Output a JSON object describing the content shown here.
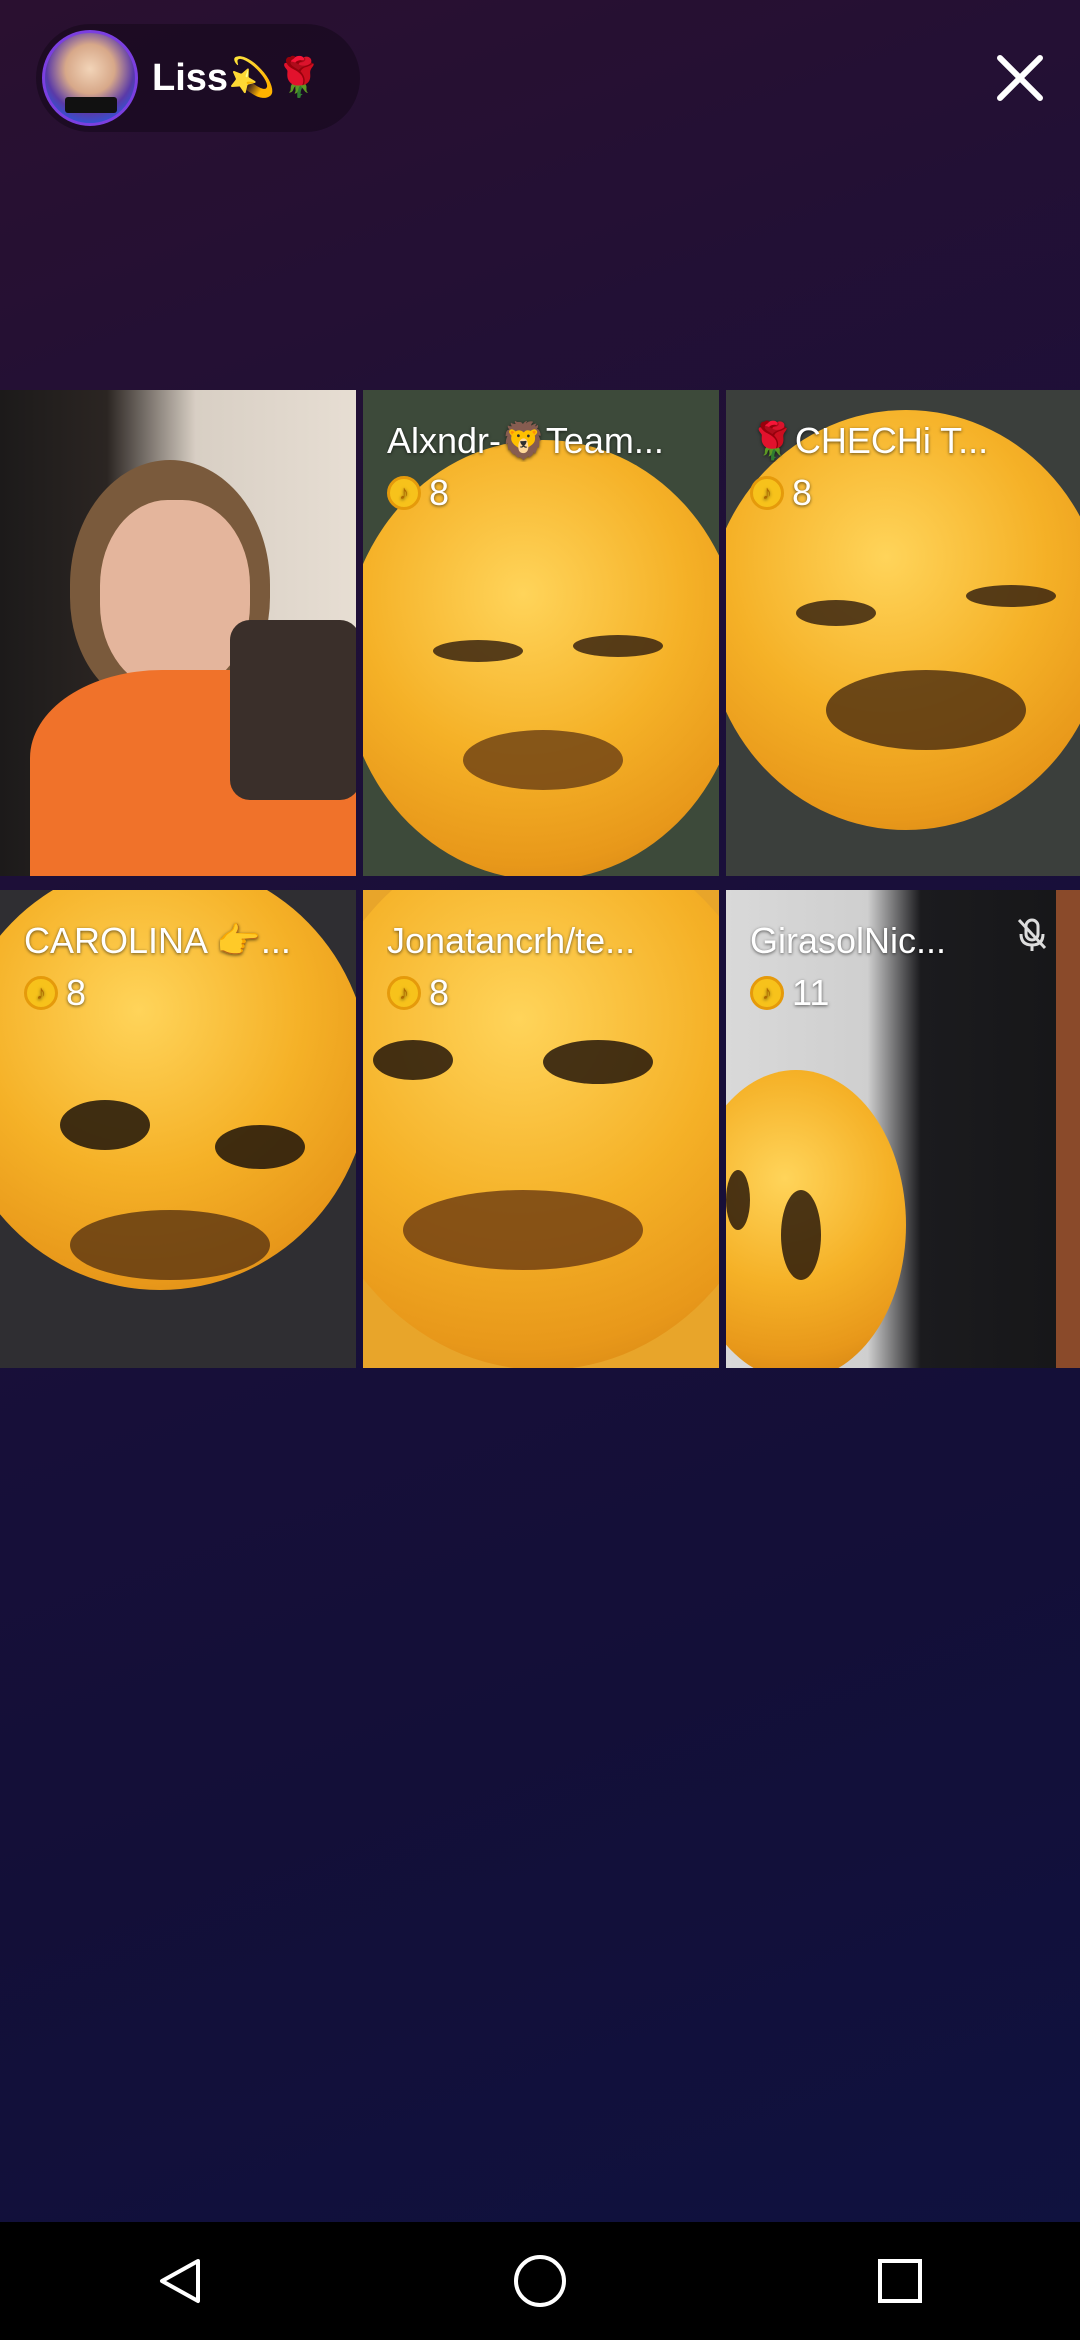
{
  "header": {
    "host_name": "Liss💫🌹",
    "close_icon": "close-icon"
  },
  "tiles": [
    {
      "name": "",
      "coins": ""
    },
    {
      "name": "Alxndr-🦁Team...",
      "coins": "8"
    },
    {
      "name": "🌹CHECHi  T...",
      "coins": "8"
    },
    {
      "name": "CAROLINA 👉...",
      "coins": "8"
    },
    {
      "name": "Jonatancrh/te...",
      "coins": "8"
    },
    {
      "name": "GirasolNic...",
      "coins": "11",
      "muted": true
    }
  ],
  "navbar": {
    "back_icon": "back-triangle-icon",
    "home_icon": "home-circle-icon",
    "recents_icon": "recents-square-icon"
  },
  "colors": {
    "background": "#1a0f3a",
    "coin": "#f7c21b"
  }
}
